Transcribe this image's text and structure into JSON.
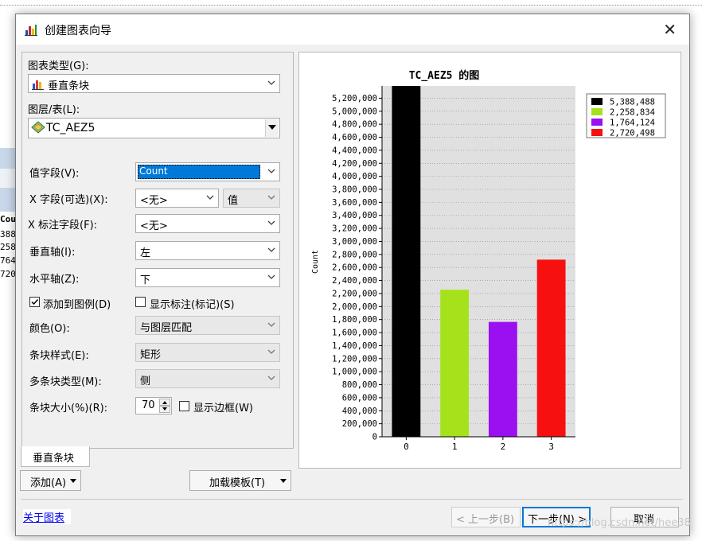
{
  "background": {
    "column_header": "Coun",
    "rows": [
      "388",
      "258",
      "764",
      "720"
    ]
  },
  "dialog": {
    "title": "创建图表向导",
    "close_glyph": "✕"
  },
  "form": {
    "chart_type_label": "图表类型(G):",
    "chart_type_value": "垂直条块",
    "layer_label": "图层/表(L):",
    "layer_value": "TC_AEZ5",
    "value_field_label": "值字段(V):",
    "value_field_value": "Count",
    "x_field_label": "X 字段(可选)(X):",
    "x_field_value": "<无>",
    "x_field_sort_value": "值",
    "x_label_field_label": "X 标注字段(F):",
    "x_label_field_value": "<无>",
    "vertical_axis_label": "垂直轴(I):",
    "vertical_axis_value": "左",
    "horizontal_axis_label": "水平轴(Z):",
    "horizontal_axis_value": "下",
    "add_to_legend_label": "添加到图例(D)",
    "add_to_legend_checked": true,
    "show_labels_label": "显示标注(标记)(S)",
    "show_labels_checked": false,
    "color_label": "颜色(O):",
    "color_value": "与图层匹配",
    "bar_style_label": "条块样式(E):",
    "bar_style_value": "矩形",
    "multi_bar_type_label": "多条块类型(M):",
    "multi_bar_type_value": "侧",
    "bar_size_label": "条块大小(%)(R):",
    "bar_size_value": "70",
    "show_border_label": "显示边框(W)",
    "show_border_checked": false
  },
  "tabs": [
    "垂直条块"
  ],
  "buttons": {
    "add": "添加(A)",
    "load_template": "加载模板(T)",
    "back": "< 上一步(B)",
    "next": "下一步(N) >",
    "cancel": "取消"
  },
  "footer": {
    "about_link": "关于图表",
    "watermark": "https://blog.csdn.net/hee38"
  },
  "chart_data": {
    "type": "bar",
    "title": "TC_AEZ5 的图",
    "ylabel": "Count",
    "xlabel": "",
    "categories": [
      "0",
      "1",
      "2",
      "3"
    ],
    "values": [
      5388488,
      2258834,
      1764124,
      2720498
    ],
    "colors": [
      "#000000",
      "#a6e21c",
      "#9a10f0",
      "#f71010"
    ],
    "legend": [
      "5,388,488",
      "2,258,834",
      "1,764,124",
      "2,720,498"
    ],
    "legend_position": "top-right",
    "ylim": [
      0,
      5388488
    ],
    "ytick_step": 200000,
    "yticks_max": 5200000,
    "grid": true,
    "plot_background": "#e0e0e0"
  }
}
